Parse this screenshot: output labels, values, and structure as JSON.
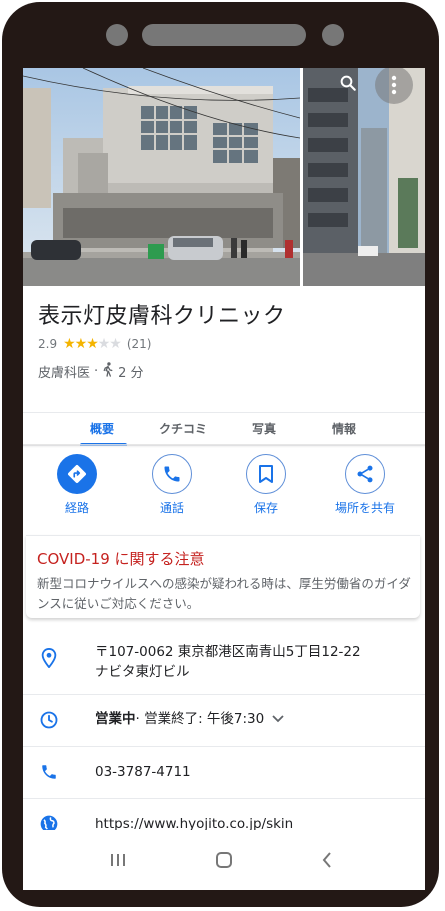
{
  "place": {
    "name": "表示灯皮膚科クリニック",
    "rating": "2.9",
    "review_count": "(21)",
    "category": "皮膚科医",
    "separator": "·",
    "walk_time": "2 分"
  },
  "tabs": [
    {
      "label": "概要"
    },
    {
      "label": "クチコミ"
    },
    {
      "label": "写真"
    },
    {
      "label": "情報"
    }
  ],
  "actions": [
    {
      "label": "経路",
      "icon": "directions-icon"
    },
    {
      "label": "通話",
      "icon": "phone-icon"
    },
    {
      "label": "保存",
      "icon": "bookmark-icon"
    },
    {
      "label": "場所を共有",
      "icon": "share-icon"
    }
  ],
  "covid": {
    "title": "COVID-19 に関する注意",
    "body": "新型コロナウイルスへの感染が疑われる時は、厚生労働省のガイダンスに従いご対応ください。"
  },
  "details": {
    "address_line1": "〒107-0062 東京都港区南青山5丁目12-22",
    "address_line2": "ナビタ東灯ビル",
    "hours_status": "営業中",
    "hours_detail": " · 営業終了: 午後7:30",
    "phone": "03-3787-4711",
    "website": "https://www.hyojito.co.jp/skin"
  },
  "colors": {
    "accent": "#1a73e8",
    "star": "#f4b400",
    "warning": "#c5221f",
    "phone_frame": "#231815"
  }
}
